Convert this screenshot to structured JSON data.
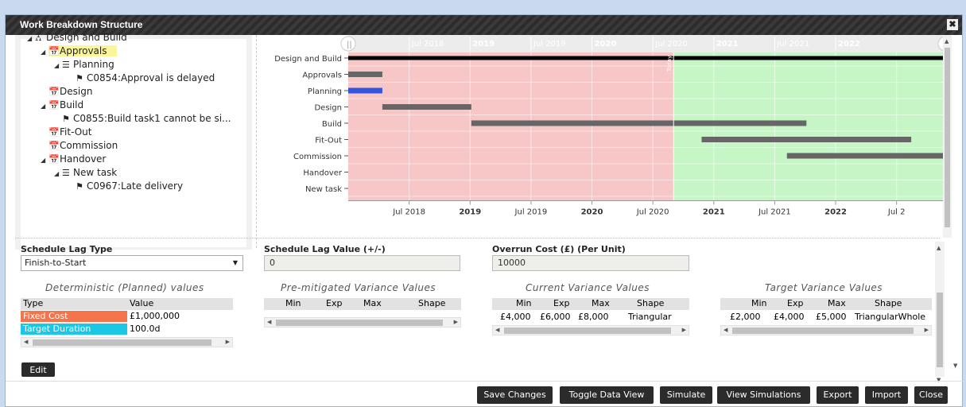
{
  "window": {
    "title": "Work Breakdown Structure",
    "close_glyph": "✖"
  },
  "tree": [
    {
      "label": "Design and Build",
      "icon": "hierarchy-icon",
      "glyph": "⛼",
      "toggle": "◢",
      "indent": 0
    },
    {
      "label": "Approvals",
      "icon": "calendar-icon",
      "glyph": "📅",
      "toggle": "◢",
      "indent": 1,
      "selected": true
    },
    {
      "label": "Planning",
      "icon": "list-icon",
      "glyph": "☰",
      "toggle": "◢",
      "indent": 2
    },
    {
      "label": "C0854:Approval is delayed",
      "icon": "flag-icon",
      "glyph": "⚑",
      "toggle": "",
      "indent": 3
    },
    {
      "label": "Design",
      "icon": "calendar-icon",
      "glyph": "📅",
      "toggle": "",
      "indent": 1
    },
    {
      "label": "Build",
      "icon": "calendar-icon",
      "glyph": "📅",
      "toggle": "◢",
      "indent": 1
    },
    {
      "label": "C0855:Build task1 cannot be si...",
      "icon": "flag-icon",
      "glyph": "⚑",
      "toggle": "",
      "indent": 2
    },
    {
      "label": "Fit-Out",
      "icon": "calendar-icon",
      "glyph": "📅",
      "toggle": "",
      "indent": 1
    },
    {
      "label": "Commission",
      "icon": "calendar-icon",
      "glyph": "📅",
      "toggle": "",
      "indent": 1
    },
    {
      "label": "Handover",
      "icon": "calendar-icon",
      "glyph": "📅",
      "toggle": "◢",
      "indent": 1
    },
    {
      "label": "New task",
      "icon": "list-icon",
      "glyph": "☰",
      "toggle": "◢",
      "indent": 2
    },
    {
      "label": "C0967:Late delivery",
      "icon": "flag-icon",
      "glyph": "⚑",
      "toggle": "",
      "indent": 3
    }
  ],
  "gantt": {
    "time_start": 2018.0,
    "time_end": 2022.9,
    "today": 2020.67,
    "today_label": "Today",
    "top_ticks": [
      "Jul 2018",
      "2019",
      "Jul 2019",
      "2020",
      "Jul 2020",
      "2021",
      "Jul 2021",
      "2022"
    ],
    "bottom_ticks": [
      {
        "label": "Jul 2018",
        "t": 2018.5,
        "bold": false
      },
      {
        "label": "2019",
        "t": 2019.0,
        "bold": true
      },
      {
        "label": "Jul 2019",
        "t": 2019.5,
        "bold": false
      },
      {
        "label": "2020",
        "t": 2020.0,
        "bold": true
      },
      {
        "label": "Jul 2020",
        "t": 2020.5,
        "bold": false
      },
      {
        "label": "2021",
        "t": 2021.0,
        "bold": true
      },
      {
        "label": "Jul 2021",
        "t": 2021.5,
        "bold": false
      },
      {
        "label": "2022",
        "t": 2022.0,
        "bold": true
      },
      {
        "label": "Jul 2",
        "t": 2022.5,
        "bold": false
      }
    ],
    "rows": [
      {
        "label": "Design and Build",
        "start": 2018.0,
        "end": 2022.9,
        "color": "#000000"
      },
      {
        "label": "Approvals",
        "start": 2018.0,
        "end": 2018.28,
        "color": "#666666"
      },
      {
        "label": "Planning",
        "start": 2018.0,
        "end": 2018.28,
        "color": "#3355dd"
      },
      {
        "label": "Design",
        "start": 2018.28,
        "end": 2019.01,
        "color": "#666666"
      },
      {
        "label": "Build",
        "start": 2019.01,
        "end": 2021.76,
        "color": "#666666"
      },
      {
        "label": "Fit-Out",
        "start": 2020.9,
        "end": 2022.62,
        "color": "#666666"
      },
      {
        "label": "Commission",
        "start": 2021.6,
        "end": 2022.9,
        "color": "#666666"
      },
      {
        "label": "Handover",
        "start": 2022.89,
        "end": 2022.9,
        "color": "#666666"
      },
      {
        "label": "New task",
        "start": 2022.89,
        "end": 2022.9,
        "color": "#3355dd"
      }
    ],
    "past_color": "#f7c6c6",
    "future_color": "#c6f5c6"
  },
  "form": {
    "lag_type_label": "Schedule Lag Type",
    "lag_type_value": "Finish-to-Start",
    "lag_value_label": "Schedule Lag Value (+/-)",
    "lag_value": "0",
    "overrun_label": "Overrun Cost (£) (Per Unit)",
    "overrun_value": "10000"
  },
  "deterministic": {
    "title": "Deterministic (Planned) values",
    "headers": [
      "Type",
      "Value"
    ],
    "rows": [
      {
        "type": "Fixed Cost",
        "value": "£1,000,000",
        "color": "#f4744c"
      },
      {
        "type": "Target Duration",
        "value": "100.0d",
        "color": "#1ac8e6"
      }
    ]
  },
  "premitigated": {
    "title": "Pre-mitigated Variance Values",
    "headers": [
      "Min",
      "Exp",
      "Max",
      "Shape"
    ]
  },
  "current": {
    "title": "Current Variance Values",
    "headers": [
      "Min",
      "Exp",
      "Max",
      "Shape"
    ],
    "row": [
      "£4,000",
      "£6,000",
      "£8,000",
      "Triangular"
    ]
  },
  "target": {
    "title": "Target Variance Values",
    "headers": [
      "Min",
      "Exp",
      "Max",
      "Shape"
    ],
    "row": [
      "£2,000",
      "£4,000",
      "£5,000",
      "TriangularWhole"
    ]
  },
  "buttons": {
    "edit": "Edit",
    "save": "Save Changes",
    "toggle": "Toggle Data View",
    "simulate": "Simulate",
    "view_sims": "View Simulations",
    "export": "Export",
    "import": "Import",
    "close": "Close"
  }
}
